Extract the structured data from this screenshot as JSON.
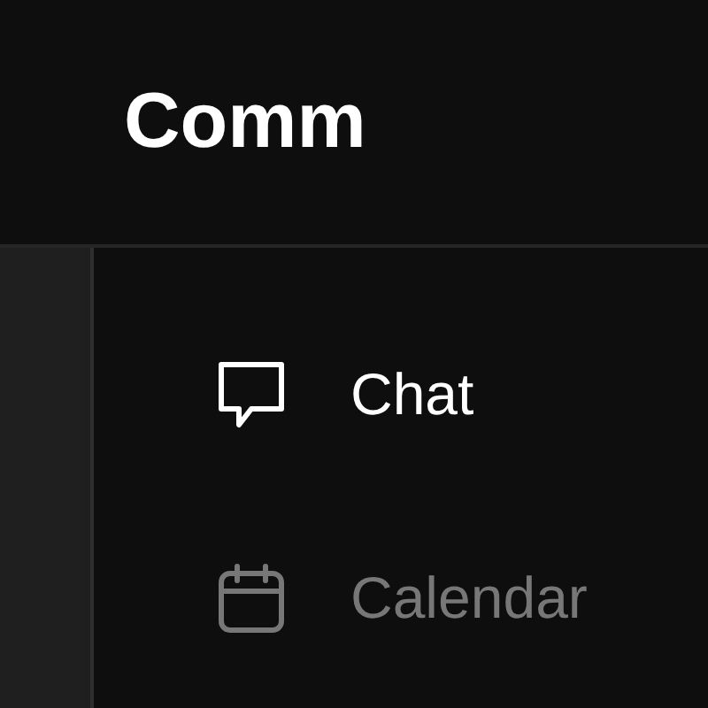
{
  "header": {
    "title": "Comm"
  },
  "nav_items": [
    {
      "label": "Chat",
      "kind": "chat",
      "selected": true
    },
    {
      "label": "Calendar",
      "kind": "calendar",
      "selected": false
    }
  ]
}
